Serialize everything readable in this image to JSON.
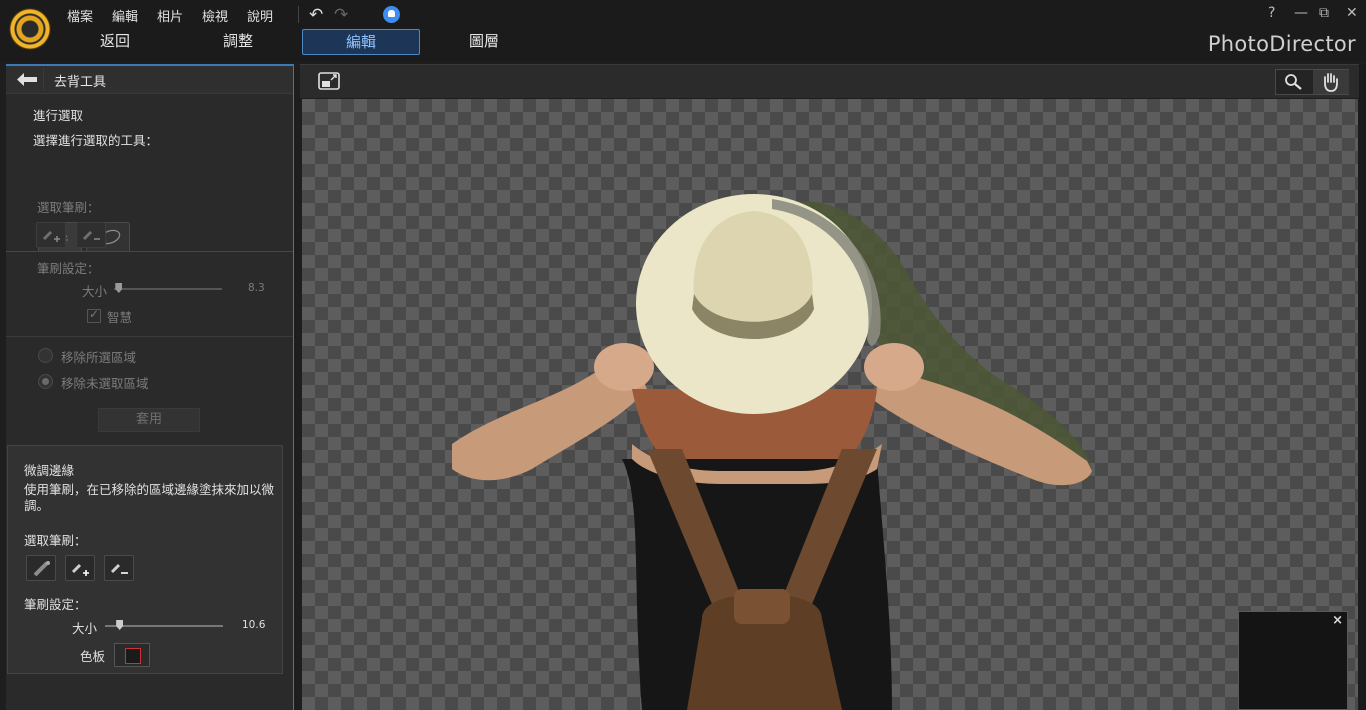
{
  "menu": {
    "items": [
      "檔案",
      "編輯",
      "相片",
      "檢視",
      "說明"
    ],
    "window_controls": [
      "?",
      "—",
      "⧉",
      "✕"
    ]
  },
  "modes": {
    "back": "返回",
    "adjust": "調整",
    "edit": "編輯",
    "layers": "圖層",
    "active": "編輯"
  },
  "brand": "PhotoDirector",
  "panel": {
    "title": "去背工具",
    "select_heading": "進行選取",
    "select_tool_prompt": "選擇進行選取的工具：",
    "brush_label": "選取筆刷：",
    "brush_settings": "筆刷設定：",
    "size_label": "大小",
    "size_value": "8.3",
    "size_fraction": 0.04,
    "smart_label": "智慧",
    "smart_checked": true,
    "remove_selected": "移除所選區域",
    "remove_unselected": "移除未選取區域",
    "remove_mode": "remove_unselected",
    "apply": "套用"
  },
  "refine": {
    "title": "微調邊緣",
    "description": "使用筆刷，在已移除的區域邊緣塗抹來加以微調。",
    "brush_label": "選取筆刷：",
    "brush_settings": "筆刷設定：",
    "size_label": "大小",
    "size_value": "10.6",
    "size_fraction": 0.12,
    "palette_label": "色板"
  },
  "colors": {
    "accent": "#3e78b8",
    "active_tab_bg": "#1d3556",
    "active_tab_text": "#8fc3ff",
    "brand_orange": "#e3a51f"
  },
  "canvas": {
    "tools": [
      "zoom-icon",
      "hand-icon"
    ],
    "selected_tool": "hand-icon",
    "navigator_close": "×"
  }
}
